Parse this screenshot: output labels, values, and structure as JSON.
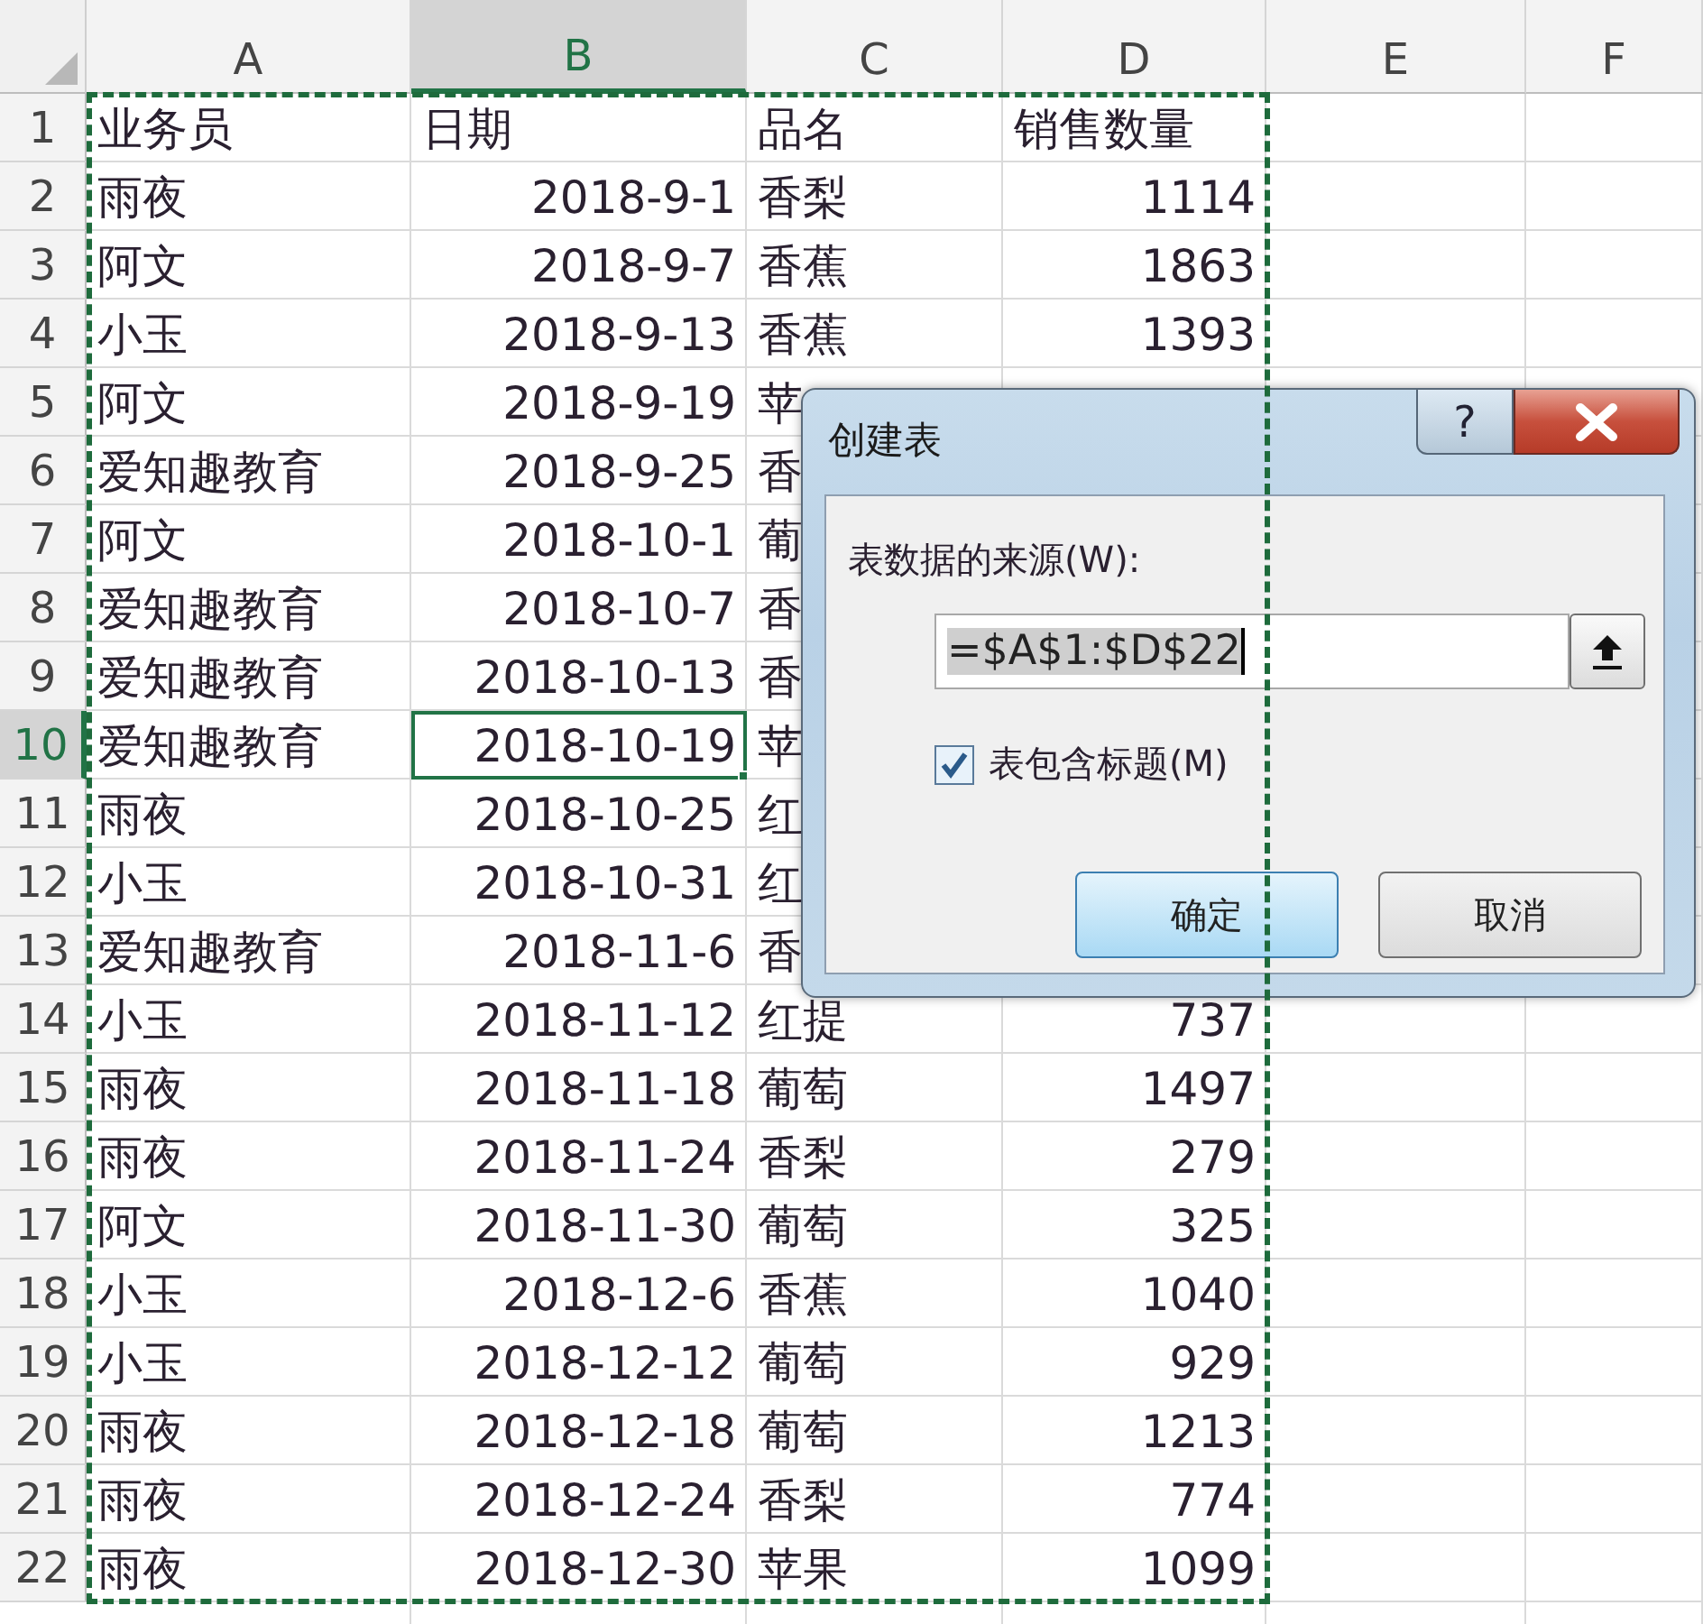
{
  "grid": {
    "copy_range": true,
    "columns": [
      {
        "label": "A",
        "kind": "text",
        "selected": false
      },
      {
        "label": "B",
        "kind": "number",
        "selected": true
      },
      {
        "label": "C",
        "kind": "text",
        "selected": false
      },
      {
        "label": "D",
        "kind": "number",
        "selected": false
      },
      {
        "label": "E",
        "kind": "text",
        "selected": false
      },
      {
        "label": "F",
        "kind": "text",
        "selected": false
      }
    ],
    "rows": [
      {
        "number": "1",
        "selected": false,
        "cells": [
          "业务员",
          "日期",
          "品名",
          "销售数量"
        ],
        "kind": "header"
      },
      {
        "number": "2",
        "selected": false,
        "cells": [
          "雨夜",
          "2018-9-1",
          "香梨",
          "1114"
        ]
      },
      {
        "number": "3",
        "selected": false,
        "cells": [
          "阿文",
          "2018-9-7",
          "香蕉",
          "1863"
        ]
      },
      {
        "number": "4",
        "selected": false,
        "cells": [
          "小玉",
          "2018-9-13",
          "香蕉",
          "1393"
        ]
      },
      {
        "number": "5",
        "selected": false,
        "cells": [
          "阿文",
          "2018-9-19",
          "苹"
        ]
      },
      {
        "number": "6",
        "selected": false,
        "cells": [
          "爱知趣教育",
          "2018-9-25",
          "香"
        ]
      },
      {
        "number": "7",
        "selected": false,
        "cells": [
          "阿文",
          "2018-10-1",
          "葡"
        ]
      },
      {
        "number": "8",
        "selected": false,
        "cells": [
          "爱知趣教育",
          "2018-10-7",
          "香"
        ]
      },
      {
        "number": "9",
        "selected": false,
        "cells": [
          "爱知趣教育",
          "2018-10-13",
          "香"
        ]
      },
      {
        "number": "10",
        "selected": true,
        "cells": [
          "爱知趣教育",
          "2018-10-19",
          "苹"
        ]
      },
      {
        "number": "11",
        "selected": false,
        "cells": [
          "雨夜",
          "2018-10-25",
          "红"
        ]
      },
      {
        "number": "12",
        "selected": false,
        "cells": [
          "小玉",
          "2018-10-31",
          "红"
        ]
      },
      {
        "number": "13",
        "selected": false,
        "cells": [
          "爱知趣教育",
          "2018-11-6",
          "香"
        ]
      },
      {
        "number": "14",
        "selected": false,
        "cells": [
          "小玉",
          "2018-11-12",
          "红提",
          "737"
        ]
      },
      {
        "number": "15",
        "selected": false,
        "cells": [
          "雨夜",
          "2018-11-18",
          "葡萄",
          "1497"
        ]
      },
      {
        "number": "16",
        "selected": false,
        "cells": [
          "雨夜",
          "2018-11-24",
          "香梨",
          "279"
        ]
      },
      {
        "number": "17",
        "selected": false,
        "cells": [
          "阿文",
          "2018-11-30",
          "葡萄",
          "325"
        ]
      },
      {
        "number": "18",
        "selected": false,
        "cells": [
          "小玉",
          "2018-12-6",
          "香蕉",
          "1040"
        ]
      },
      {
        "number": "19",
        "selected": false,
        "cells": [
          "小玉",
          "2018-12-12",
          "葡萄",
          "929"
        ]
      },
      {
        "number": "20",
        "selected": false,
        "cells": [
          "雨夜",
          "2018-12-18",
          "葡萄",
          "1213"
        ]
      },
      {
        "number": "21",
        "selected": false,
        "cells": [
          "雨夜",
          "2018-12-24",
          "香梨",
          "774"
        ]
      },
      {
        "number": "22",
        "selected": false,
        "cells": [
          "雨夜",
          "2018-12-30",
          "苹果",
          "1099"
        ]
      }
    ]
  },
  "dialog": {
    "title": "创建表",
    "help_button": "?",
    "source_label": "表数据的来源(W):",
    "range_value": "=$A$1:$D$22",
    "has_headers": {
      "label": "表包含标题(M)",
      "checked": true
    },
    "buttons": [
      {
        "label": "确定",
        "default": true
      },
      {
        "label": "取消",
        "default": false
      }
    ]
  }
}
